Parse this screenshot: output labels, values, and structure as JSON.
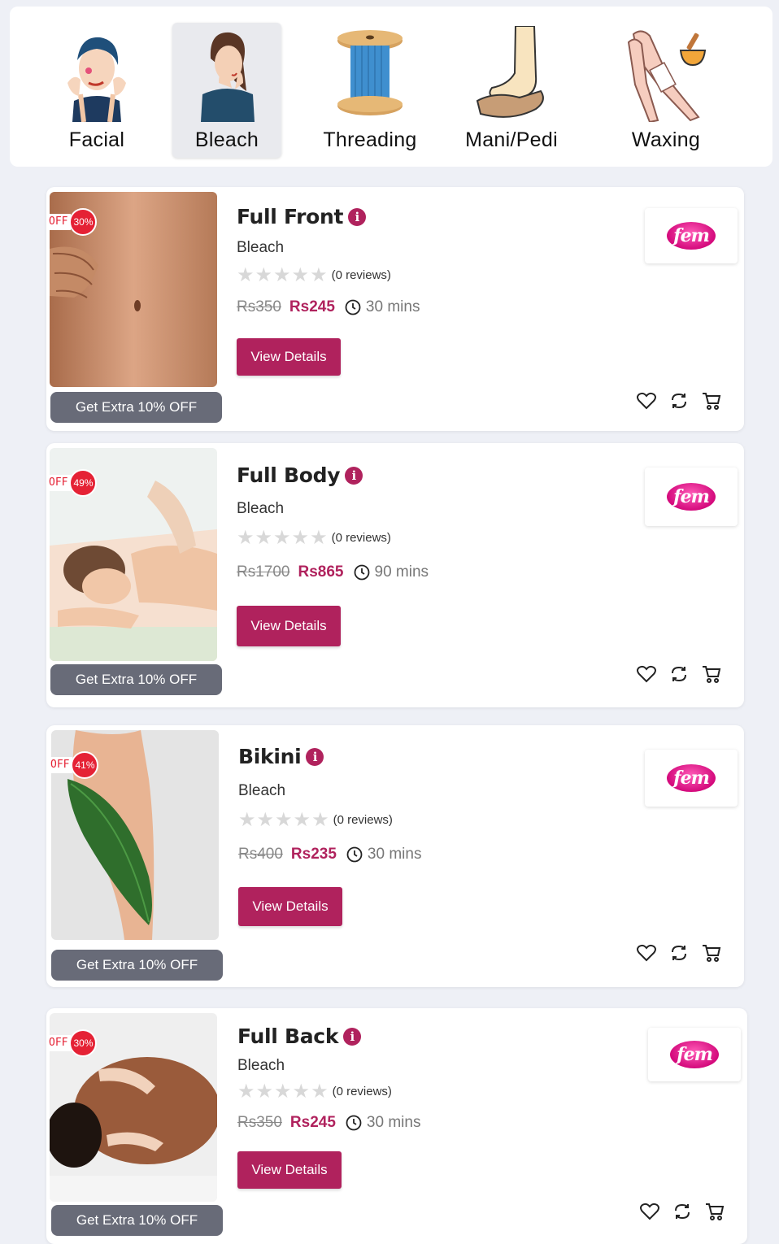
{
  "categories": [
    {
      "label": "Facial",
      "icon": "facial-icon"
    },
    {
      "label": "Bleach",
      "icon": "bleach-icon",
      "active": true
    },
    {
      "label": "Threading",
      "icon": "thread-spool-icon"
    },
    {
      "label": "Mani/Pedi",
      "icon": "foot-hand-icon"
    },
    {
      "label": "Waxing",
      "icon": "wax-legs-icon"
    }
  ],
  "colors": {
    "accent": "#b0225d",
    "badge": "#e52235",
    "extra_bg": "#686b78",
    "brand_pink": "#d40a7c"
  },
  "common": {
    "off_label": "OFF",
    "extra_label": "Get Extra 10% OFF",
    "view_details": "View Details",
    "brand": "fem",
    "info_glyph": "i"
  },
  "products": [
    {
      "title": "Full Front",
      "category": "Bleach",
      "discount": "30%",
      "reviews": "(0 reviews)",
      "old_price": "Rs350",
      "new_price": "Rs245",
      "duration": "30 mins"
    },
    {
      "title": "Full Body",
      "category": "Bleach",
      "discount": "49%",
      "reviews": "(0 reviews)",
      "old_price": "Rs1700",
      "new_price": "Rs865",
      "duration": "90 mins"
    },
    {
      "title": "Bikini",
      "category": "Bleach",
      "discount": "41%",
      "reviews": "(0 reviews)",
      "old_price": "Rs400",
      "new_price": "Rs235",
      "duration": "30 mins"
    },
    {
      "title": "Full Back",
      "category": "Bleach",
      "discount": "30%",
      "reviews": "(0 reviews)",
      "old_price": "Rs350",
      "new_price": "Rs245",
      "duration": "30 mins"
    }
  ]
}
